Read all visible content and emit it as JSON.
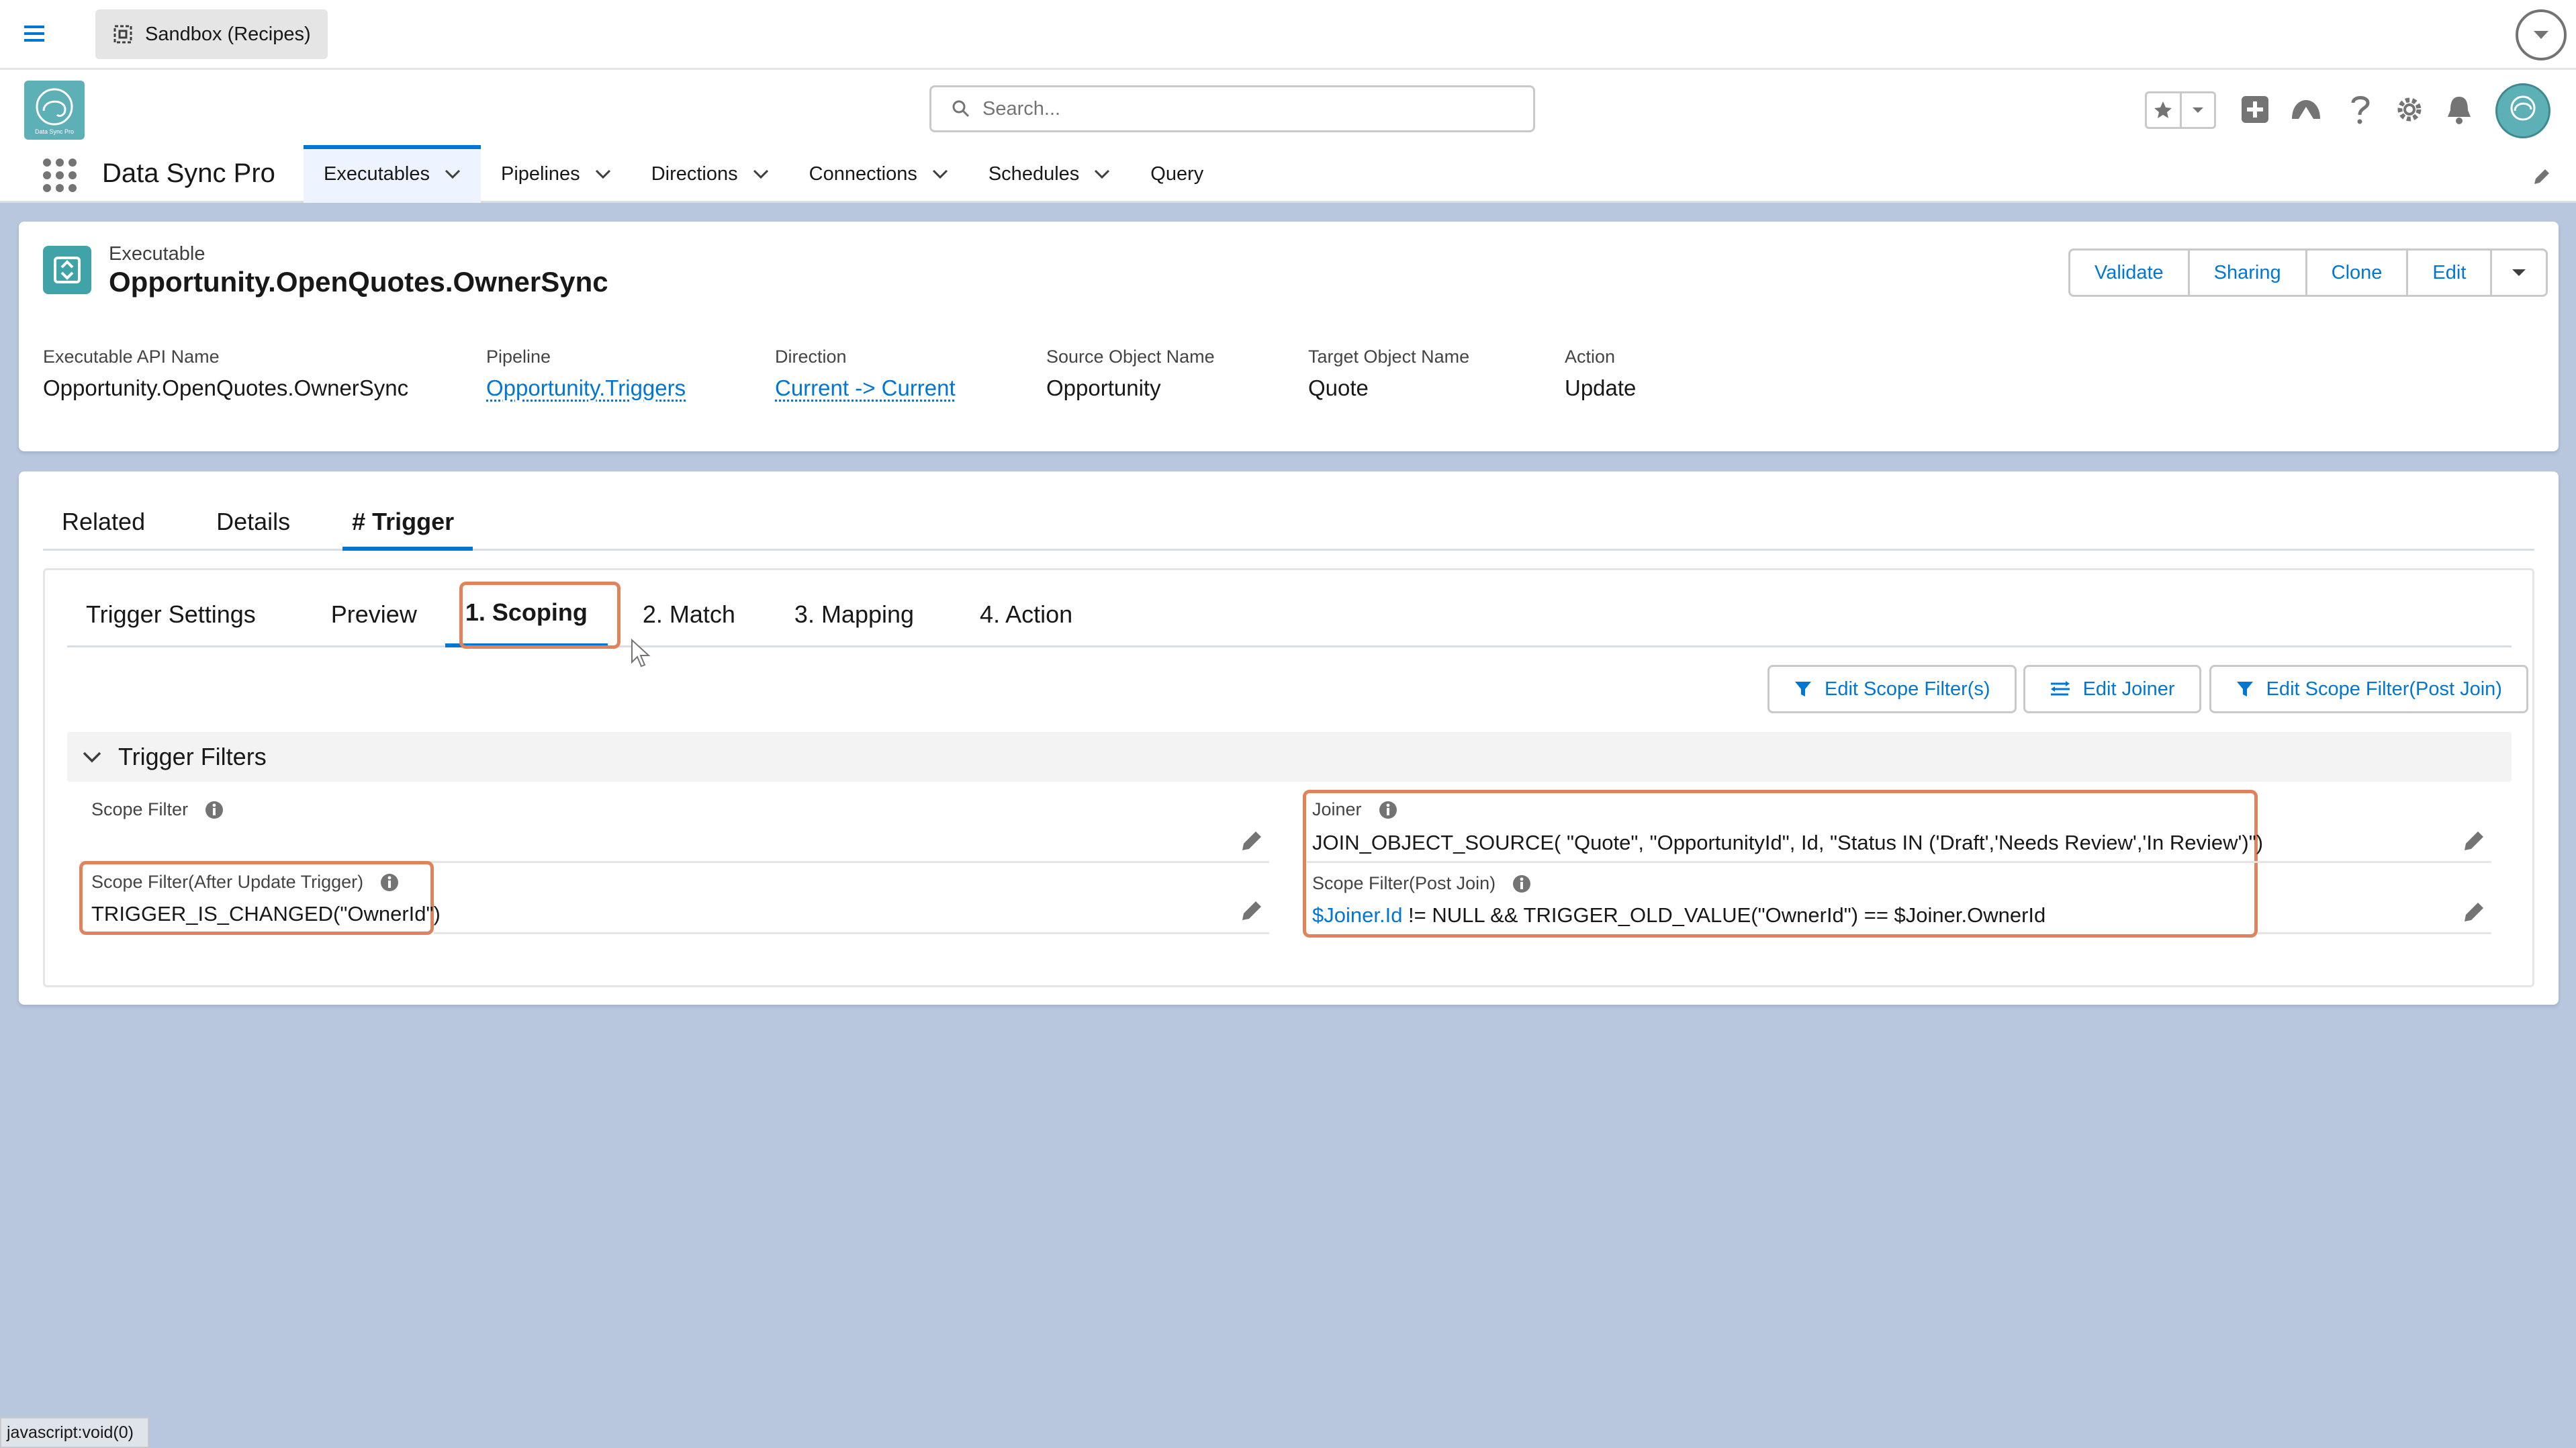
{
  "topbar": {
    "sandbox_label": "Sandbox (Recipes)"
  },
  "header": {
    "search_placeholder": "Search...",
    "app_name": "Data Sync Pro",
    "logo_text": "Data Sync Pro"
  },
  "nav": {
    "items": [
      {
        "label": "Executables",
        "has_menu": true,
        "active": true
      },
      {
        "label": "Pipelines",
        "has_menu": true
      },
      {
        "label": "Directions",
        "has_menu": true
      },
      {
        "label": "Connections",
        "has_menu": true
      },
      {
        "label": "Schedules",
        "has_menu": true
      },
      {
        "label": "Query",
        "has_menu": false
      }
    ]
  },
  "record": {
    "object_type": "Executable",
    "title": "Opportunity.OpenQuotes.OwnerSync",
    "actions": [
      "Validate",
      "Sharing",
      "Clone",
      "Edit"
    ],
    "fields": {
      "api_name_label": "Executable API Name",
      "api_name_value": "Opportunity.OpenQuotes.OwnerSync",
      "pipeline_label": "Pipeline",
      "pipeline_value": "Opportunity.Triggers",
      "direction_label": "Direction",
      "direction_value": "Current -> Current",
      "source_label": "Source Object Name",
      "source_value": "Opportunity",
      "target_label": "Target Object Name",
      "target_value": "Quote",
      "action_label": "Action",
      "action_value": "Update"
    }
  },
  "tabs": {
    "related": "Related",
    "details": "Details",
    "trigger": "# Trigger"
  },
  "subtabs": {
    "settings": "Trigger Settings",
    "preview": "Preview",
    "scoping": "1. Scoping",
    "match": "2. Match",
    "mapping": "3. Mapping",
    "action": "4. Action"
  },
  "filter_buttons": {
    "edit_scope": "Edit Scope Filter(s)",
    "edit_joiner": "Edit Joiner",
    "edit_post_join": "Edit Scope Filter(Post Join)"
  },
  "section": {
    "title": "Trigger Filters",
    "scope_filter_label": "Scope Filter",
    "scope_filter_after_label": "Scope Filter(After Update Trigger)",
    "scope_filter_after_value": "TRIGGER_IS_CHANGED(\"OwnerId\")",
    "joiner_label": "Joiner",
    "joiner_value": "JOIN_OBJECT_SOURCE( \"Quote\", \"OpportunityId\", Id, \"Status IN ('Draft','Needs Review','In Review')\")",
    "post_join_label": "Scope Filter(Post Join)",
    "post_join_link": "$Joiner.Id",
    "post_join_rest": " != NULL && TRIGGER_OLD_VALUE(\"OwnerId\") == $Joiner.OwnerId"
  },
  "status_bar": "javascript:void(0)",
  "colors": {
    "accent": "#0176d3",
    "highlight": "#e0835c",
    "page_bg": "#b8c7de",
    "logo": "#5db0b6"
  }
}
